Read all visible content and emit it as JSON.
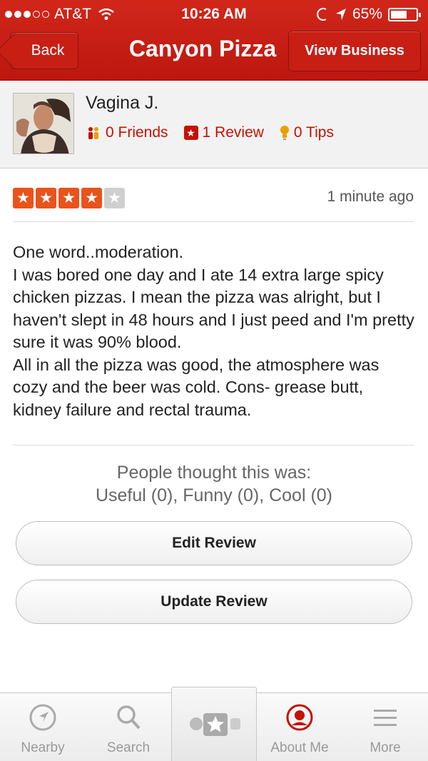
{
  "status_bar": {
    "carrier": "AT&T",
    "time": "10:26 AM",
    "battery": "65%",
    "battery_level": 0.65
  },
  "nav": {
    "back_label": "Back",
    "title": "Canyon Pizza",
    "view_business_label": "View Business"
  },
  "user": {
    "name": "Vagina J.",
    "friends": "0 Friends",
    "reviews": "1 Review",
    "tips": "0 Tips"
  },
  "review": {
    "rating": 4,
    "max_rating": 5,
    "time_ago": "1 minute ago",
    "lines": [
      "One word..moderation.",
      "I was bored one day and I ate 14 extra large spicy chicken pizzas. I mean the pizza was alright, but I haven't slept in 48 hours and I just peed and I'm pretty sure it was 90% blood.",
      "All in all the pizza was good, the atmosphere was cozy and the beer was cold. Cons- grease butt, kidney failure and rectal trauma."
    ]
  },
  "feedback": {
    "heading": "People thought this was:",
    "votes": "Useful (0), Funny (0), Cool (0)"
  },
  "actions": {
    "edit_label": "Edit Review",
    "update_label": "Update Review"
  },
  "tabs": [
    {
      "label": "Nearby",
      "icon": "compass-icon"
    },
    {
      "label": "Search",
      "icon": "magnifier-icon"
    },
    {
      "label": "",
      "icon": "check-in-star-icon"
    },
    {
      "label": "About Me",
      "icon": "profile-icon",
      "active": true
    },
    {
      "label": "More",
      "icon": "menu-lines-icon"
    }
  ],
  "colors": {
    "brand_red": "#c41200",
    "star_orange": "#e9531c"
  }
}
